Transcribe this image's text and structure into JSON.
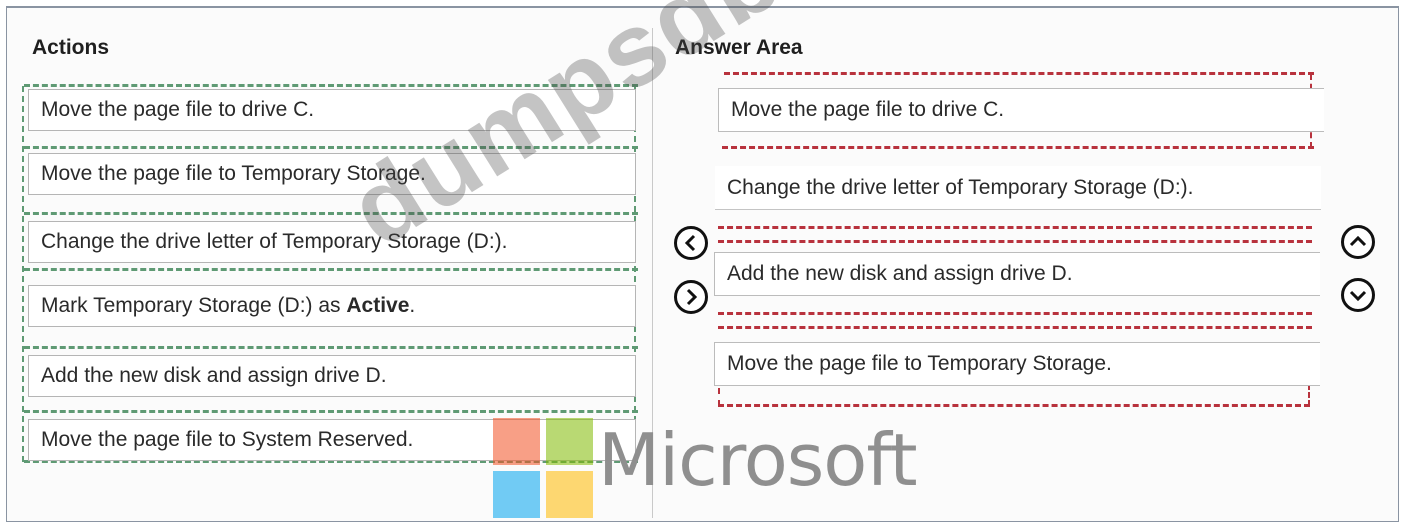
{
  "actions": {
    "heading": "Actions",
    "items": [
      {
        "label": "Move the page file to drive C."
      },
      {
        "label": "Move the page file to Temporary Storage."
      },
      {
        "label": "Change the drive letter of Temporary Storage (D:)."
      },
      {
        "label_prefix": "Mark Temporary Storage (D:) as ",
        "label_bold": "Active",
        "label_suffix": "."
      },
      {
        "label": "Add the new disk and assign drive D."
      },
      {
        "label": "Move the page file to System Reserved."
      }
    ]
  },
  "answer_area": {
    "heading": "Answer Area",
    "items": [
      {
        "label": "Move the page file to drive C."
      },
      {
        "label": "Change the drive letter of Temporary Storage (D:)."
      },
      {
        "label": "Add the new disk and assign drive D."
      },
      {
        "label": "Move the page file to Temporary Storage."
      }
    ]
  },
  "controls": {
    "move_left": "chevron-left-icon",
    "move_right": "chevron-right-icon",
    "move_up": "chevron-up-icon",
    "move_down": "chevron-down-icon"
  },
  "watermark": {
    "text": "dumpsdb.com"
  },
  "logo": {
    "text": "Microsoft",
    "colors": [
      "#f25022",
      "#7fba00",
      "#00a4ef",
      "#ffb900"
    ]
  },
  "colors": {
    "action_dash": "#5f9a74",
    "answer_dash": "#b8323d"
  }
}
